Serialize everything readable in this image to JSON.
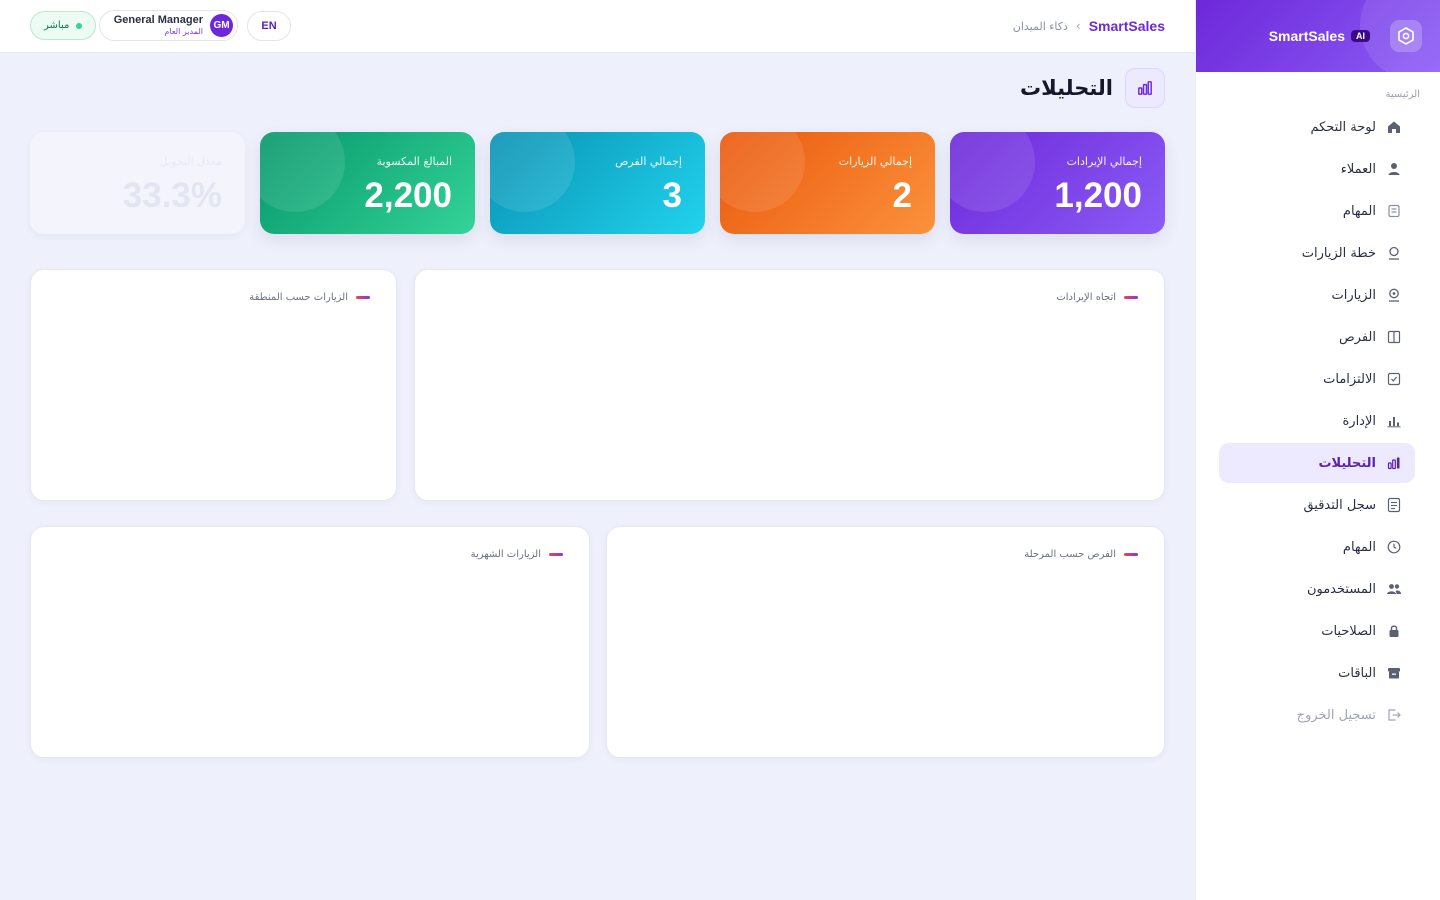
{
  "app": {
    "brand": "SmartSales",
    "ai_badge": "AI"
  },
  "breadcrumb": {
    "brand": "SmartSales",
    "separator": "›",
    "page": "ذكاء الميدان"
  },
  "topbar": {
    "live_label": "مباشر",
    "user_name": "General Manager",
    "user_role": "المدير العام",
    "avatar_initials": "GM",
    "lang_label": "EN"
  },
  "sidebar": {
    "section_label": "الرئيسية",
    "items": [
      {
        "label": "لوحة التحكم",
        "icon": "home-icon"
      },
      {
        "label": "العملاء",
        "icon": "user-icon"
      },
      {
        "label": "المهام",
        "icon": "list-icon"
      },
      {
        "label": "خطة الزيارات",
        "icon": "pin-icon"
      },
      {
        "label": "الزيارات",
        "icon": "location-icon"
      },
      {
        "label": "الفرص",
        "icon": "columns-icon"
      },
      {
        "label": "الالتزامات",
        "icon": "check-square-icon"
      },
      {
        "label": "الإدارة",
        "icon": "bar-chart-icon"
      },
      {
        "label": "التحليلات",
        "icon": "analytics-icon",
        "active": true
      },
      {
        "label": "سجل التدقيق",
        "icon": "document-icon"
      },
      {
        "label": "المهام",
        "icon": "clock-icon"
      },
      {
        "label": "المستخدمون",
        "icon": "users-icon"
      },
      {
        "label": "الصلاحيات",
        "icon": "lock-icon"
      },
      {
        "label": "الباقات",
        "icon": "package-icon"
      }
    ],
    "logout_label": "تسجيل الخروج"
  },
  "page": {
    "title": "التحليلات"
  },
  "stats": [
    {
      "label": "إجمالي الإيرادات",
      "value": "1,200",
      "color": "#7c3aed"
    },
    {
      "label": "إجمالي الزيارات",
      "value": "2",
      "color": "#f97316"
    },
    {
      "label": "إجمالي الفرص",
      "value": "3",
      "color": "#06b6d4"
    },
    {
      "label": "المبالغ المكسوبة",
      "value": "2,200",
      "color": "#10b981"
    },
    {
      "label": "معدل التحويل",
      "value": "33.3%",
      "color": "#eef0fb"
    }
  ],
  "charts": {
    "revenue_trend": "اتجاه الإيرادات",
    "visits_by_region": "الزيارات حسب المنطقة",
    "opportunities_by_stage": "الفرص حسب المرحلة",
    "monthly_visits": "الزيارات الشهرية"
  },
  "colors": {
    "accent": "#6d28d9",
    "active_bg": "#ede9fe",
    "background": "#eef0fb"
  }
}
